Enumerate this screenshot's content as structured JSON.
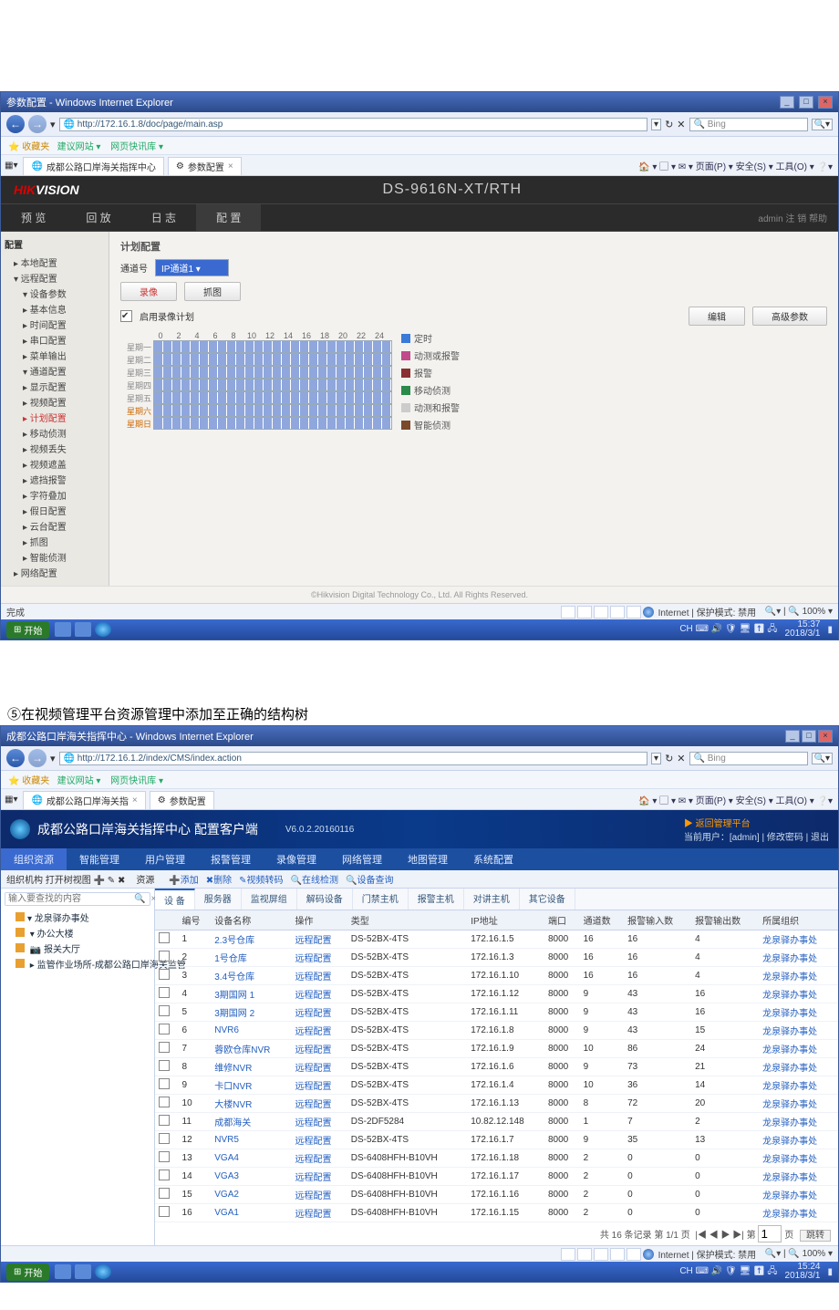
{
  "shot1": {
    "winTitle": "参数配置 - Windows Internet Explorer",
    "url": "http://172.16.1.8/doc/page/main.asp",
    "favLabel": "收藏夹",
    "favLinks": [
      "建议网站 ▾",
      "网页快讯库 ▾"
    ],
    "tabs": [
      "成都公路口岸海关指挥中心",
      "参数配置"
    ],
    "toolStrip": "🏠 ▾ ▢ ▾ ✉ ▾ 页面(P) ▾ 安全(S) ▾ 工具(O) ▾ ❔▾",
    "searchPlaceholder": "Bing",
    "hk": {
      "logo1": "HIK",
      "logo2": "VISION",
      "model": "DS-9616N-XT/RTH",
      "nav": [
        "预 览",
        "回 放",
        "日 志",
        "配 置"
      ],
      "user": "admin  注 销  帮助",
      "sideTitle": "配置",
      "tree": [
        {
          "t": "▸ 本地配置",
          "c": ""
        },
        {
          "t": "▾ 远程配置",
          "c": ""
        },
        {
          "t": "▾ 设备参数",
          "c": "sub"
        },
        {
          "t": "▸ 基本信息",
          "c": "sub"
        },
        {
          "t": "▸ 时间配置",
          "c": "sub"
        },
        {
          "t": "▸ 串口配置",
          "c": "sub"
        },
        {
          "t": "▸ 菜单输出",
          "c": "sub"
        },
        {
          "t": "▾ 通道配置",
          "c": "sub"
        },
        {
          "t": "▸ 显示配置",
          "c": "sub"
        },
        {
          "t": "▸ 视频配置",
          "c": "sub"
        },
        {
          "t": "▸ 计划配置",
          "c": "sub on"
        },
        {
          "t": "▸ 移动侦测",
          "c": "sub"
        },
        {
          "t": "▸ 视频丢失",
          "c": "sub"
        },
        {
          "t": "▸ 视频遮盖",
          "c": "sub"
        },
        {
          "t": "▸ 遮挡报警",
          "c": "sub"
        },
        {
          "t": "▸ 字符叠加",
          "c": "sub"
        },
        {
          "t": "▸ 假日配置",
          "c": "sub"
        },
        {
          "t": "▸ 云台配置",
          "c": "sub"
        },
        {
          "t": "▸ 抓图",
          "c": "sub"
        },
        {
          "t": "▸ 智能侦测",
          "c": "sub"
        },
        {
          "t": "▸ 网络配置",
          "c": ""
        }
      ],
      "panelTitle": "计划配置",
      "chanLabel": "通道号",
      "chanValue": "IP通道1",
      "btnRec": "录像",
      "btnCap": "抓图",
      "enable": "启用录像计划",
      "btnEdit": "编辑",
      "btnAdv": "高级参数",
      "hours": [
        "0",
        "2",
        "4",
        "6",
        "8",
        "10",
        "12",
        "14",
        "16",
        "18",
        "20",
        "22",
        "24"
      ],
      "days": [
        "星期一",
        "星期二",
        "星期三",
        "星期四",
        "星期五",
        "星期六",
        "星期日"
      ],
      "legend": [
        {
          "c": "#3a7ad8",
          "t": "定时"
        },
        {
          "c": "#c04a8a",
          "t": "动测或报警"
        },
        {
          "c": "#8a3030",
          "t": "报警"
        },
        {
          "c": "#2a8a4a",
          "t": "移动侦测"
        },
        {
          "c": "#ccc",
          "t": "动测和报警"
        },
        {
          "c": "#7a4a2a",
          "t": "智能侦测"
        }
      ],
      "copyright": "©Hikvision Digital Technology Co., Ltd. All Rights Reserved."
    },
    "statusDone": "完成",
    "statusZone": "Internet | 保护模式: 禁用",
    "zoom": "100%",
    "startLabel": "开始",
    "clock": {
      "t": "15:37",
      "d": "2018/3/1"
    }
  },
  "caption": "⑤在视频管理平台资源管理中添加至正确的结构树",
  "shot2": {
    "winTitle": "成都公路口岸海关指挥中心 - Windows Internet Explorer",
    "url": "http://172.16.1.2/index/CMS/index.action",
    "favLabel": "收藏夹",
    "favLinks": [
      "建议网站 ▾",
      "网页快讯库 ▾"
    ],
    "tabs": [
      "成都公路口岸海关指",
      "参数配置"
    ],
    "toolStrip": "🏠 ▾ ▢ ▾ ✉ ▾ 页面(P) ▾ 安全(S) ▾ 工具(O) ▾ ❔▾",
    "searchPlaceholder": "Bing",
    "plat": {
      "title": "成都公路口岸海关指挥中心 配置客户端",
      "ver": "V6.0.2.20160116",
      "rightTop": "▶ 返回管理平台",
      "rightUser": "当前用户：[admin] | 修改密码 | 退出",
      "menu": [
        "组织资源",
        "智能管理",
        "用户管理",
        "报警管理",
        "录像管理",
        "网络管理",
        "地图管理",
        "系统配置"
      ],
      "toolCrumb": "组织机构    打开树视图 ➕ ✎ ✖",
      "toolCrumb2": "资源",
      "toolActions": [
        "➕添加",
        "✖删除",
        "✎视频转码",
        "🔍在线检测",
        "🔍设备查询"
      ],
      "searchPlaceholder": "输入要查找的内容",
      "tree": [
        "▾ 龙泉驿办事处",
        "  ▾ 办公大楼",
        "    📷 报关大厅",
        "  ▸ 监管作业场所-成都公路口岸海关监管"
      ],
      "subtabs": [
        "设 备",
        "服务器",
        "监视屏组",
        "解码设备",
        "门禁主机",
        "报警主机",
        "对讲主机",
        "其它设备"
      ],
      "cols": [
        "",
        "编号",
        "设备名称",
        "操作",
        "类型",
        "IP地址",
        "端口",
        "通道数",
        "报警输入数",
        "报警输出数",
        "所属组织"
      ],
      "rows": [
        [
          "1",
          "2.3号仓库",
          "远程配置",
          "DS-52BX-4TS",
          "172.16.1.5",
          "8000",
          "16",
          "16",
          "4",
          "龙泉驿办事处"
        ],
        [
          "2",
          "1号仓库",
          "远程配置",
          "DS-52BX-4TS",
          "172.16.1.3",
          "8000",
          "16",
          "16",
          "4",
          "龙泉驿办事处"
        ],
        [
          "3",
          "3.4号仓库",
          "远程配置",
          "DS-52BX-4TS",
          "172.16.1.10",
          "8000",
          "16",
          "16",
          "4",
          "龙泉驿办事处"
        ],
        [
          "4",
          "3期国网 1",
          "远程配置",
          "DS-52BX-4TS",
          "172.16.1.12",
          "8000",
          "9",
          "43",
          "16",
          "龙泉驿办事处"
        ],
        [
          "5",
          "3期国网 2",
          "远程配置",
          "DS-52BX-4TS",
          "172.16.1.11",
          "8000",
          "9",
          "43",
          "16",
          "龙泉驿办事处"
        ],
        [
          "6",
          "NVR6",
          "远程配置",
          "DS-52BX-4TS",
          "172.16.1.8",
          "8000",
          "9",
          "43",
          "15",
          "龙泉驿办事处"
        ],
        [
          "7",
          "蓉欧仓库NVR",
          "远程配置",
          "DS-52BX-4TS",
          "172.16.1.9",
          "8000",
          "10",
          "86",
          "24",
          "龙泉驿办事处"
        ],
        [
          "8",
          "维修NVR",
          "远程配置",
          "DS-52BX-4TS",
          "172.16.1.6",
          "8000",
          "9",
          "73",
          "21",
          "龙泉驿办事处"
        ],
        [
          "9",
          "卡口NVR",
          "远程配置",
          "DS-52BX-4TS",
          "172.16.1.4",
          "8000",
          "10",
          "36",
          "14",
          "龙泉驿办事处"
        ],
        [
          "10",
          "大楼NVR",
          "远程配置",
          "DS-52BX-4TS",
          "172.16.1.13",
          "8000",
          "8",
          "72",
          "20",
          "龙泉驿办事处"
        ],
        [
          "11",
          "成都海关",
          "远程配置",
          "DS-2DF5284",
          "10.82.12.148",
          "8000",
          "1",
          "7",
          "2",
          "龙泉驿办事处"
        ],
        [
          "12",
          "NVR5",
          "远程配置",
          "DS-52BX-4TS",
          "172.16.1.7",
          "8000",
          "9",
          "35",
          "13",
          "龙泉驿办事处"
        ],
        [
          "13",
          "VGA4",
          "远程配置",
          "DS-6408HFH-B10VH",
          "172.16.1.18",
          "8000",
          "2",
          "0",
          "0",
          "龙泉驿办事处"
        ],
        [
          "14",
          "VGA3",
          "远程配置",
          "DS-6408HFH-B10VH",
          "172.16.1.17",
          "8000",
          "2",
          "0",
          "0",
          "龙泉驿办事处"
        ],
        [
          "15",
          "VGA2",
          "远程配置",
          "DS-6408HFH-B10VH",
          "172.16.1.16",
          "8000",
          "2",
          "0",
          "0",
          "龙泉驿办事处"
        ],
        [
          "16",
          "VGA1",
          "远程配置",
          "DS-6408HFH-B10VH",
          "172.16.1.15",
          "8000",
          "2",
          "0",
          "0",
          "龙泉驿办事处"
        ]
      ],
      "pager": {
        "total": "共 16 条记录  第 1/1 页",
        "nav": "|◀  ◀  ▶  ▶|  第",
        "page": "1",
        "unit": "页",
        "go": "跳转"
      }
    },
    "statusZone": "Internet | 保护模式: 禁用",
    "zoom": "100%",
    "startLabel": "开始",
    "clock": {
      "t": "15:24",
      "d": "2018/3/1"
    }
  }
}
